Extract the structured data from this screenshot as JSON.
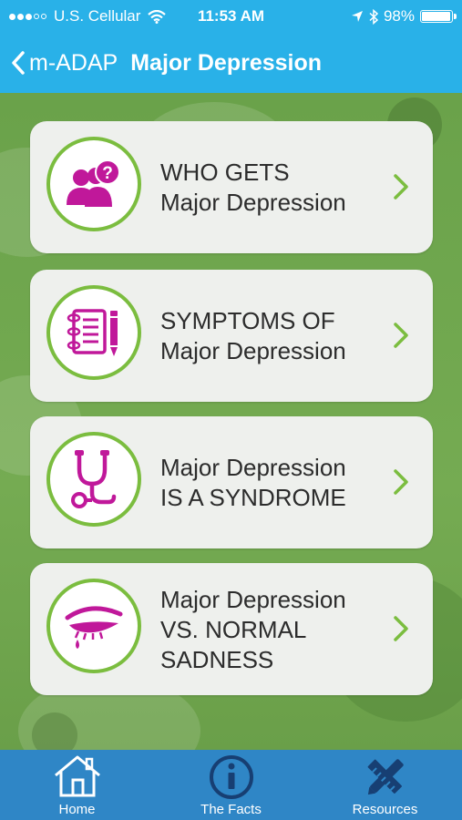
{
  "status_bar": {
    "carrier": "U.S. Cellular",
    "time": "11:53 AM",
    "battery_percent": "98%",
    "battery_level": 0.98
  },
  "nav": {
    "back_label": "m-ADAP",
    "title": "Major Depression"
  },
  "cards": [
    {
      "line1": "WHO GETS",
      "line2": "Major Depression",
      "line3": "",
      "icon": "people-question-icon"
    },
    {
      "line1": "SYMPTOMS OF",
      "line2": "Major Depression",
      "line3": "",
      "icon": "notebook-pencil-icon"
    },
    {
      "line1": "Major Depression",
      "line2": "IS A SYNDROME",
      "line3": "",
      "icon": "stethoscope-icon"
    },
    {
      "line1": "Major Depression",
      "line2": "VS. NORMAL",
      "line3": "SADNESS",
      "icon": "crying-eye-icon"
    }
  ],
  "tabs": [
    {
      "label": "Home",
      "icon": "home-icon"
    },
    {
      "label": "The Facts",
      "icon": "info-icon"
    },
    {
      "label": "Resources",
      "icon": "tools-icon"
    }
  ],
  "colors": {
    "nav_blue": "#29b1e8",
    "tab_blue": "#2f86c6",
    "background_green": "#6aa24a",
    "accent_green": "#7bbd3f",
    "icon_magenta": "#c0189a"
  }
}
